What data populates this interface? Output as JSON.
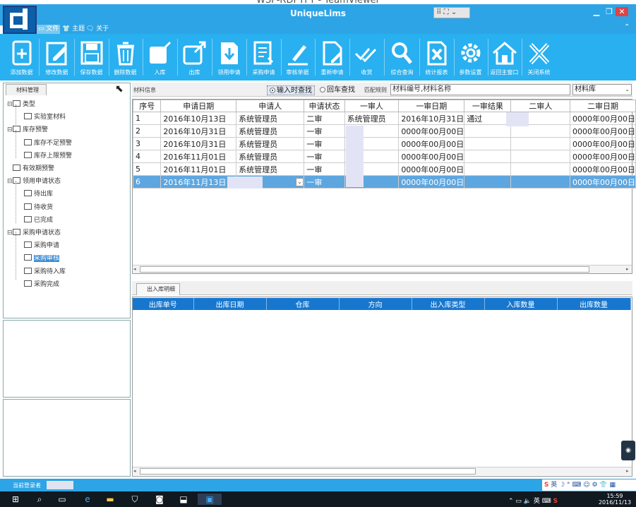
{
  "window": {
    "teamviewer_title": "WSP-RDPTFT - TeamViewer",
    "app_title": "UniqueLims",
    "min_icon": "minimize-icon",
    "max_icon": "restore-icon",
    "close_icon": "close-icon"
  },
  "menu": [
    "文件",
    "主题",
    "关于"
  ],
  "toolbar": [
    {
      "label": "添加数据",
      "icon": "add-file-icon"
    },
    {
      "label": "修改数据",
      "icon": "edit-icon"
    },
    {
      "label": "保存数据",
      "icon": "save-icon"
    },
    {
      "label": "删除数据",
      "icon": "trash-icon"
    },
    {
      "label": "入库",
      "icon": "stock-in-icon"
    },
    {
      "label": "出库",
      "icon": "stock-out-icon"
    },
    {
      "label": "领用申请",
      "icon": "download-icon"
    },
    {
      "label": "采购申请",
      "icon": "purchase-doc-icon"
    },
    {
      "label": "审核单据",
      "icon": "pen-icon"
    },
    {
      "label": "重新申请",
      "icon": "doc-edit-icon"
    },
    {
      "label": "收货",
      "icon": "double-check-icon"
    },
    {
      "label": "综合查询",
      "icon": "search-icon"
    },
    {
      "label": "统计报表",
      "icon": "excel-icon"
    },
    {
      "label": "参数设置",
      "icon": "gear-icon"
    },
    {
      "label": "返回主窗口",
      "icon": "home-icon"
    },
    {
      "label": "关闭系统",
      "icon": "close-x-icon"
    }
  ],
  "left_panel": {
    "tab": "材料管理"
  },
  "tree": [
    {
      "label": "类型",
      "level": 0,
      "toggle": "⊟"
    },
    {
      "label": "实验室材料",
      "level": 1
    },
    {
      "label": "库存预警",
      "level": 0,
      "toggle": "⊟"
    },
    {
      "label": "库存不足预警",
      "level": 1
    },
    {
      "label": "库存上限预警",
      "level": 1
    },
    {
      "label": "有效期预警",
      "level": 0
    },
    {
      "label": "领用申请状态",
      "level": 0,
      "toggle": "⊟"
    },
    {
      "label": "待出库",
      "level": 1
    },
    {
      "label": "待收货",
      "level": 1
    },
    {
      "label": "已完成",
      "level": 1
    },
    {
      "label": "采购申请状态",
      "level": 0,
      "toggle": "⊟"
    },
    {
      "label": "采购申请",
      "level": 1
    },
    {
      "label": "采购审核",
      "level": 1,
      "selected": true
    },
    {
      "label": "采购待入库",
      "level": 1
    },
    {
      "label": "采购完成",
      "level": 1
    }
  ],
  "info_bar": {
    "label": "材料信息",
    "radio_input": "输入时查找",
    "radio_enter": "回车查找",
    "match_label": "匹配规则",
    "search_value": "材料编号,材料名称",
    "library": "材料库"
  },
  "grid": {
    "columns": [
      "序号",
      "申请日期",
      "申请人",
      "申请状态",
      "一审人",
      "一审日期",
      "一审结果",
      "二审人",
      "二审日期"
    ],
    "rows": [
      [
        "1",
        "2016年10月13日",
        "系统管理员",
        "二审",
        "系统管理员",
        "2016年10月31日",
        "通过",
        "",
        "0000年00月00日"
      ],
      [
        "2",
        "2016年10月31日",
        "系统管理员",
        "一审",
        "",
        "0000年00月00日",
        "",
        "",
        "0000年00月00日"
      ],
      [
        "3",
        "2016年10月31日",
        "系统管理员",
        "一审",
        "",
        "0000年00月00日",
        "",
        "",
        "0000年00月00日"
      ],
      [
        "4",
        "2016年11月01日",
        "系统管理员",
        "一审",
        "",
        "0000年00月00日",
        "",
        "",
        "0000年00月00日"
      ],
      [
        "5",
        "2016年11月01日",
        "系统管理员",
        "一审",
        "",
        "0000年00月00日",
        "",
        "",
        "0000年00月00日"
      ],
      [
        "6",
        "2016年11月13日",
        "",
        "一审",
        "",
        "0000年00月00日",
        "",
        "",
        "0000年00月00日"
      ]
    ]
  },
  "detail": {
    "tab": "出入库明细",
    "columns": [
      "出库单号",
      "出库日期",
      "仓库",
      "方向",
      "出入库类型",
      "入库数量",
      "出库数量"
    ]
  },
  "status": {
    "login_label": "当前登录者"
  },
  "ime": {
    "lang": "英"
  },
  "taskbar": {
    "time": "15:59",
    "date": "2016/11/13",
    "ime": "英"
  }
}
